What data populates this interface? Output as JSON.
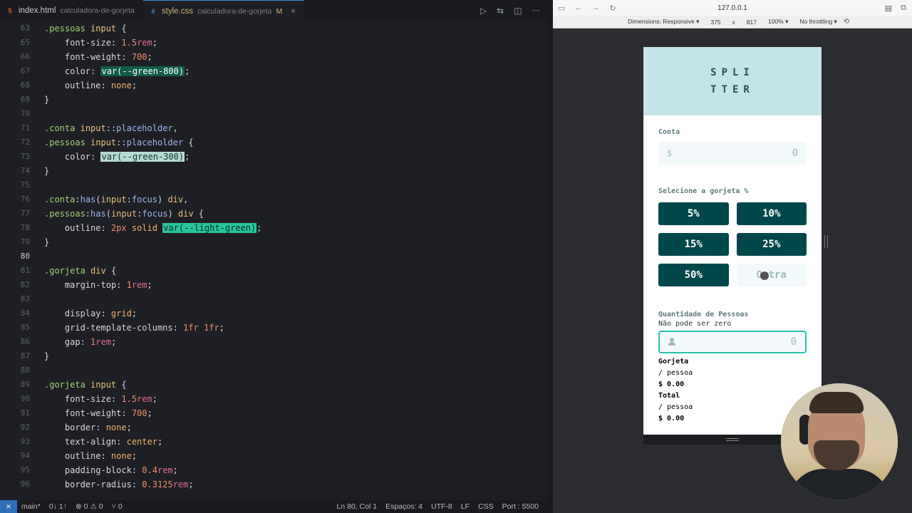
{
  "editor": {
    "tabs": [
      {
        "icon": "html-file-icon",
        "name": "index.html",
        "desc": "calculadora-de-gorjeta",
        "modified": ""
      },
      {
        "icon": "css-file-icon",
        "name": "style.css",
        "desc": "calculadora-de-gorjeta",
        "modified": "M"
      }
    ],
    "close_glyph": "×",
    "actions": [
      "run-icon",
      "compare-icon",
      "split-editor-icon",
      "more-icon"
    ],
    "lines": [
      {
        "n": "63",
        "text": ".pessoas input {"
      },
      {
        "n": "65",
        "text": "    font-size: 1.5rem;"
      },
      {
        "n": "66",
        "text": "    font-weight: 700;"
      },
      {
        "n": "67",
        "text": "    color: var(--green-800);"
      },
      {
        "n": "68",
        "text": "    outline: none;"
      },
      {
        "n": "69",
        "text": "}"
      },
      {
        "n": "70",
        "text": ""
      },
      {
        "n": "71",
        "text": ".conta input::placeholder,"
      },
      {
        "n": "72",
        "text": ".pessoas input::placeholder {"
      },
      {
        "n": "73",
        "text": "    color: var(--green-300);"
      },
      {
        "n": "74",
        "text": "}"
      },
      {
        "n": "75",
        "text": ""
      },
      {
        "n": "76",
        "text": ".conta:has(input:focus) div,"
      },
      {
        "n": "77",
        "text": ".pessoas:has(input:focus) div {"
      },
      {
        "n": "78",
        "text": "    outline: 2px solid var(--light-green);"
      },
      {
        "n": "79",
        "text": "}"
      },
      {
        "n": "80",
        "text": ""
      },
      {
        "n": "81",
        "text": ".gorjeta div {"
      },
      {
        "n": "82",
        "text": "    margin-top: 1rem;"
      },
      {
        "n": "83",
        "text": ""
      },
      {
        "n": "84",
        "text": "    display: grid;"
      },
      {
        "n": "85",
        "text": "    grid-template-columns: 1fr 1fr;"
      },
      {
        "n": "86",
        "text": "    gap: 1rem;"
      },
      {
        "n": "87",
        "text": "}"
      },
      {
        "n": "88",
        "text": ""
      },
      {
        "n": "89",
        "text": ".gorjeta input {"
      },
      {
        "n": "90",
        "text": "    font-size: 1.5rem;"
      },
      {
        "n": "91",
        "text": "    font-weight: 700;"
      },
      {
        "n": "92",
        "text": "    border: none;"
      },
      {
        "n": "93",
        "text": "    text-align: center;"
      },
      {
        "n": "94",
        "text": "    outline: none;"
      },
      {
        "n": "95",
        "text": "    padding-block: 0.4rem;"
      },
      {
        "n": "96",
        "text": "    border-radius: 0.3125rem;"
      }
    ],
    "status": {
      "branch": "main*",
      "sync": "0↓ 1↑",
      "problems": "⊗ 0 ⚠ 0",
      "ports": "⑂ 0",
      "position": "Ln 80, Col 1",
      "spaces": "Espaços: 4",
      "encoding": "UTF-8",
      "eol": "LF",
      "language": "CSS",
      "port": "Port : 5500"
    }
  },
  "browser": {
    "url": "127.0.0.1",
    "device_toolbar": {
      "dimensions": "Dimensions: Responsive ▾",
      "width": "375",
      "x": "x",
      "height": "817",
      "zoom": "100% ▾",
      "throttling": "No throttling ▾"
    },
    "app": {
      "logo_line1": "SPLI",
      "logo_line2": "TTER",
      "bill_label": "Conta",
      "bill_prefix": "$",
      "bill_placeholder": "0",
      "tip_label": "Selecione a gorjeta %",
      "tips": [
        "5%",
        "10%",
        "15%",
        "25%",
        "50%"
      ],
      "tip_custom": "Outra",
      "people_label": "Quantidade de Pessoas",
      "people_error": "Não pode ser zero",
      "people_placeholder": "0",
      "tip_title": "Gorjeta",
      "per_person": "/ pessoa",
      "tip_amount": "$ 0.00",
      "total_title": "Total",
      "total_per_person": "/ pessoa",
      "total_amount": "$ 0.00"
    }
  },
  "colors": {
    "tip_button": "#00474b",
    "header_bg": "#c5e4e7",
    "focus_outline": "#26c2ad"
  }
}
